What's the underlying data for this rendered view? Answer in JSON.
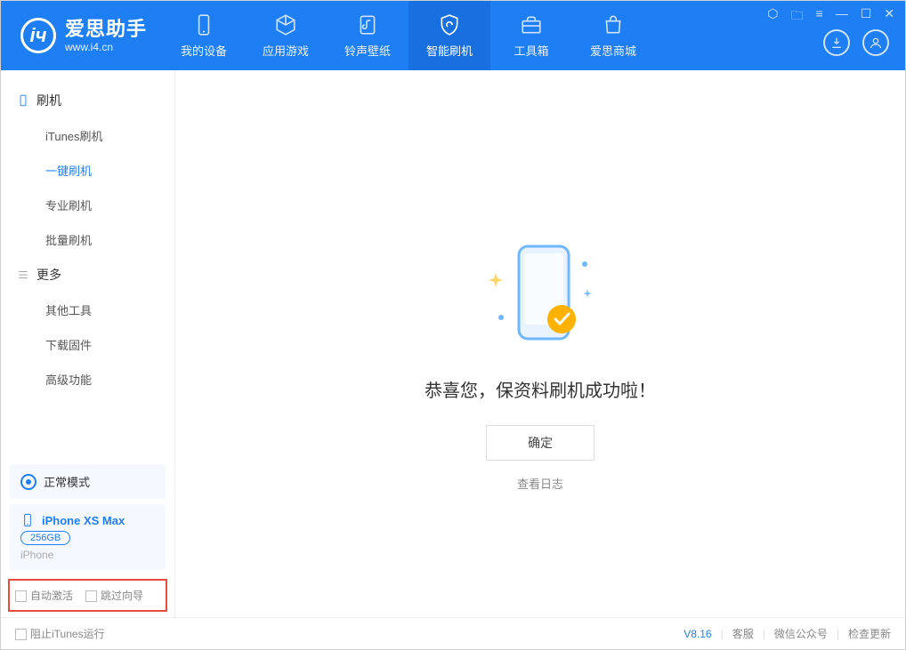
{
  "app": {
    "name": "爱思助手",
    "url": "www.i4.cn"
  },
  "tabs": [
    {
      "label": "我的设备"
    },
    {
      "label": "应用游戏"
    },
    {
      "label": "铃声壁纸"
    },
    {
      "label": "智能刷机"
    },
    {
      "label": "工具箱"
    },
    {
      "label": "爱思商城"
    }
  ],
  "sidebar": {
    "section1": {
      "title": "刷机",
      "items": [
        "iTunes刷机",
        "一键刷机",
        "专业刷机",
        "批量刷机"
      ]
    },
    "section2": {
      "title": "更多",
      "items": [
        "其他工具",
        "下载固件",
        "高级功能"
      ]
    }
  },
  "status": {
    "mode": "正常模式"
  },
  "device": {
    "name": "iPhone XS Max",
    "capacity": "256GB",
    "type": "iPhone"
  },
  "options": {
    "auto_activate": "自动激活",
    "skip_guide": "跳过向导"
  },
  "main": {
    "success_msg": "恭喜您，保资料刷机成功啦！",
    "ok_btn": "确定",
    "view_log": "查看日志"
  },
  "footer": {
    "block_itunes": "阻止iTunes运行",
    "version": "V8.16",
    "support": "客服",
    "wechat": "微信公众号",
    "check_update": "检查更新"
  }
}
